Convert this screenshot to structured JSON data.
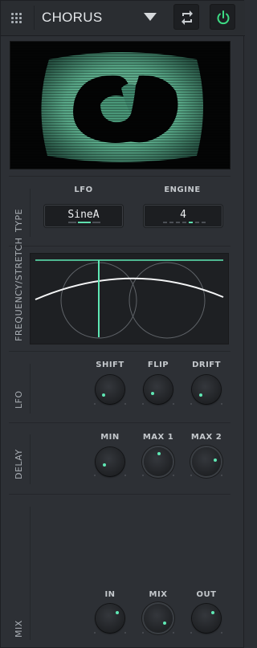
{
  "header": {
    "title": "CHORUS",
    "power_color": "#3ddc84",
    "icons": [
      "grip-icon",
      "dropdown-caret-icon",
      "swap-icon",
      "power-icon"
    ]
  },
  "type": {
    "section_label": "TYPE",
    "lfo_label": "LFO",
    "lfo_value": "SineA",
    "engine_label": "ENGINE",
    "engine_value": "4"
  },
  "frequency": {
    "section_label": "FREQUENCY/STRETCH"
  },
  "lfo": {
    "section_label": "LFO",
    "knobs": [
      {
        "label": "SHIFT",
        "value": 0.1
      },
      {
        "label": "FLIP",
        "value": 0.15
      },
      {
        "label": "DRIFT",
        "value": 0.1
      }
    ]
  },
  "delay": {
    "section_label": "DELAY",
    "knobs": [
      {
        "label": "MIN",
        "value": 0.2
      },
      {
        "label": "MAX 1",
        "value": 0.5
      },
      {
        "label": "MAX 2",
        "value": 0.75
      }
    ]
  },
  "mix": {
    "section_label": "MIX",
    "knobs": [
      {
        "label": "IN",
        "value": 0.72
      },
      {
        "label": "MIX",
        "value": 0.35
      },
      {
        "label": "OUT",
        "value": 0.72
      }
    ]
  },
  "accent_color": "#5fe8b4"
}
